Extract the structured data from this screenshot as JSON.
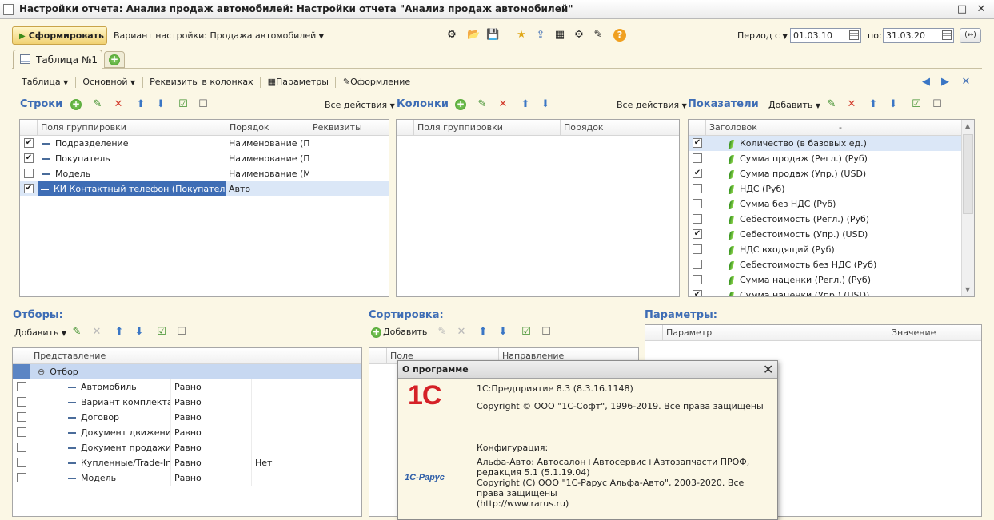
{
  "window": {
    "title": "Настройки отчета: Анализ продаж автомобилей: Настройки отчета \"Анализ продаж автомобилей\"",
    "controls": [
      "_",
      "□",
      "✕"
    ]
  },
  "toolbar": {
    "generate_label": "Сформировать",
    "variant_label": "Вариант настройки: Продажа автомобилей",
    "period_from_label": "Период с",
    "period_from": "01.03.10",
    "period_to_label": "по:",
    "period_to": "31.03.20",
    "period_btn": "(↔)"
  },
  "tabs": {
    "active": "Таблица №1"
  },
  "subtoolbar": {
    "table": "Таблица",
    "main": "Основной",
    "requisites_cols": "Реквизиты в колонках",
    "params": "Параметры",
    "design": "Оформление"
  },
  "rows_panel": {
    "title": "Строки",
    "all_actions": "Все действия",
    "columns": [
      "Поля группировки",
      "Порядок",
      "Реквизиты"
    ],
    "items": [
      {
        "checked": true,
        "field": "Подразделение",
        "order": "Наименование (П..."
      },
      {
        "checked": true,
        "field": "Покупатель",
        "order": "Наименование (П..."
      },
      {
        "checked": false,
        "field": "Модель",
        "order": "Наименование (М..."
      },
      {
        "checked": true,
        "field": "КИ Контактный телефон (Покупатель)",
        "order": "Авто"
      }
    ]
  },
  "columns_panel": {
    "title": "Колонки",
    "all_actions": "Все действия",
    "columns": [
      "Поля группировки",
      "Порядок"
    ]
  },
  "indicators_panel": {
    "title": "Показатели",
    "add": "Добавить",
    "header": "Заголовок",
    "header_sort": "-",
    "items": [
      {
        "checked": true,
        "name": "Количество (в базовых ед.)"
      },
      {
        "checked": false,
        "name": "Сумма продаж (Регл.) (Руб)"
      },
      {
        "checked": true,
        "name": "Сумма продаж (Упр.) (USD)"
      },
      {
        "checked": false,
        "name": "НДС (Руб)"
      },
      {
        "checked": false,
        "name": "Сумма без НДС (Руб)"
      },
      {
        "checked": false,
        "name": "Себестоимость (Регл.) (Руб)"
      },
      {
        "checked": true,
        "name": "Себестоимость (Упр.) (USD)"
      },
      {
        "checked": false,
        "name": "НДС входящий (Руб)"
      },
      {
        "checked": false,
        "name": "Себестоимость без НДС (Руб)"
      },
      {
        "checked": false,
        "name": "Сумма наценки (Регл.) (Руб)"
      },
      {
        "checked": true,
        "name": "Сумма наценки (Упр.) (USD)"
      }
    ]
  },
  "filters_panel": {
    "title": "Отборы:",
    "add": "Добавить",
    "column": "Представление",
    "group": "Отбор",
    "items": [
      {
        "name": "Автомобиль",
        "cond": "Равно",
        "value": ""
      },
      {
        "name": "Вариант комплекта...",
        "cond": "Равно",
        "value": ""
      },
      {
        "name": "Договор",
        "cond": "Равно",
        "value": ""
      },
      {
        "name": "Документ движения",
        "cond": "Равно",
        "value": ""
      },
      {
        "name": "Документ продажи",
        "cond": "Равно",
        "value": ""
      },
      {
        "name": "Купленные/Trade-In",
        "cond": "Равно",
        "value": "Нет"
      },
      {
        "name": "Модель",
        "cond": "Равно",
        "value": ""
      }
    ]
  },
  "sort_panel": {
    "title": "Сортировка:",
    "add": "Добавить",
    "columns": [
      "Поле",
      "Направление"
    ]
  },
  "params_panel": {
    "title": "Параметры:",
    "columns": [
      "Параметр",
      "Значение"
    ]
  },
  "about_dialog": {
    "title": "О программе",
    "platform": "1С:Предприятие 8.3 (8.3.16.1148)",
    "copyright": "Copyright © ООО \"1С-Софт\", 1996-2019. Все права защищены",
    "config_label": "Конфигурация:",
    "config_name": "Альфа-Авто: Автосалон+Автосервис+Автозапчасти ПРОФ, редакция 5.1 (5.1.19.04)",
    "config_copyright": "Copyright (C) ООО \"1С-Рарус Альфа-Авто\", 2003-2020. Все права защищены",
    "config_url": "(http://www.rarus.ru)",
    "logo_1c": "1С",
    "logo_rarus": "1С-Рарус"
  }
}
